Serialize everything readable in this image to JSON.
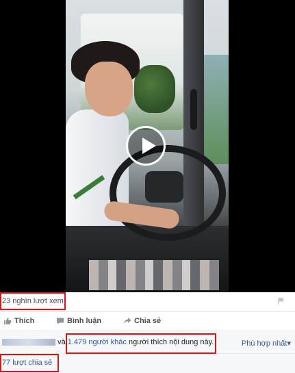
{
  "video": {
    "play_icon": "play-icon"
  },
  "stats": {
    "views": "23 nghìn lượt xem",
    "flag_icon": "flag-icon"
  },
  "actions": [
    {
      "label": "Thích",
      "icon": "thumbs-up-icon"
    },
    {
      "label": "Bình luận",
      "icon": "comment-icon"
    },
    {
      "label": "Chia sẻ",
      "icon": "share-icon"
    }
  ],
  "likes": {
    "conjunction": "và",
    "others_link": "1.479 người khác",
    "suffix": "người thích nội dung này.",
    "sort_label": "Phù hợp nhất",
    "sort_arrow": "▾"
  },
  "shares": {
    "label": "77 lượt chia sẻ"
  },
  "colors": {
    "link": "#365899",
    "highlight": "#e0101a",
    "muted": "#4b4f56"
  }
}
